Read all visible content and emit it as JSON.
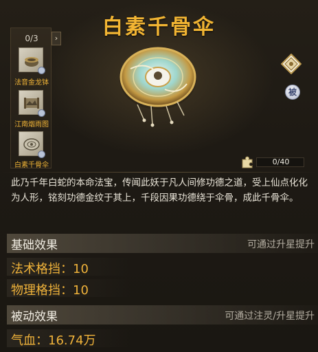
{
  "title": "白素千骨伞",
  "collection": {
    "count": "0/3",
    "items": [
      {
        "label": "法音金龙钵",
        "icon": "bowl-icon"
      },
      {
        "label": "江南烟雨图",
        "icon": "scroll-painting-icon"
      },
      {
        "label": "白素千骨伞",
        "icon": "umbrella-icon"
      }
    ]
  },
  "badges": {
    "passive": "被"
  },
  "fragments": {
    "text": "0/40",
    "progress": 0
  },
  "description": "此乃千年白蛇的本命法宝，传闻此妖于凡人间修功德之道，受上仙点化化为人形，铭刻功德金纹于其上，千段因果功德绕于伞骨，成此千骨伞。",
  "basic_effects": {
    "title": "基础效果",
    "hint": "可通过升星提升",
    "stats": [
      "法术格挡：10",
      "物理格挡：10"
    ]
  },
  "passive_effects": {
    "title": "被动效果",
    "hint": "可通过注灵/升星提升",
    "stats": [
      "气血：16.74万"
    ]
  },
  "colors": {
    "gold": "#f2b533",
    "stat": "#efb23a",
    "text": "#e9e4d8",
    "hint": "#b4aea2"
  }
}
